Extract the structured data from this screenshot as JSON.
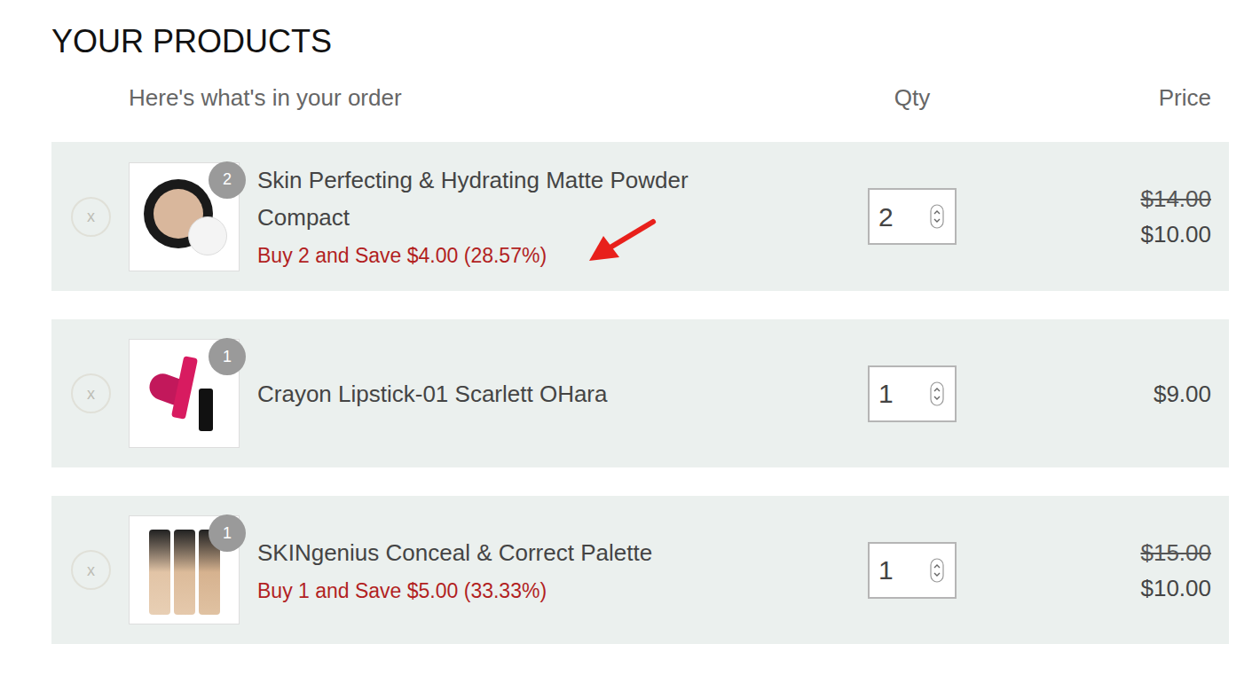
{
  "heading": "YOUR PRODUCTS",
  "columns": {
    "items": "Here's what's in your order",
    "qty": "Qty",
    "price": "Price"
  },
  "items": [
    {
      "name": "Skin Perfecting & Hydrating Matte Powder Compact",
      "badge": "2",
      "qty": "2",
      "original_price": "$14.00",
      "price": "$10.00",
      "discount": "Buy 2 and Save $4.00 (28.57%)",
      "highlighted": true,
      "kind": "compact",
      "remove": "x"
    },
    {
      "name": "Crayon Lipstick-01 Scarlett OHara",
      "badge": "1",
      "qty": "1",
      "price": "$9.00",
      "highlighted": false,
      "kind": "lipstick",
      "remove": "x"
    },
    {
      "name": "SKINgenius Conceal & Correct Palette",
      "badge": "1",
      "qty": "1",
      "original_price": "$15.00",
      "price": "$10.00",
      "discount": "Buy 1 and Save $5.00 (33.33%)",
      "highlighted": false,
      "kind": "palette",
      "remove": "x"
    }
  ]
}
